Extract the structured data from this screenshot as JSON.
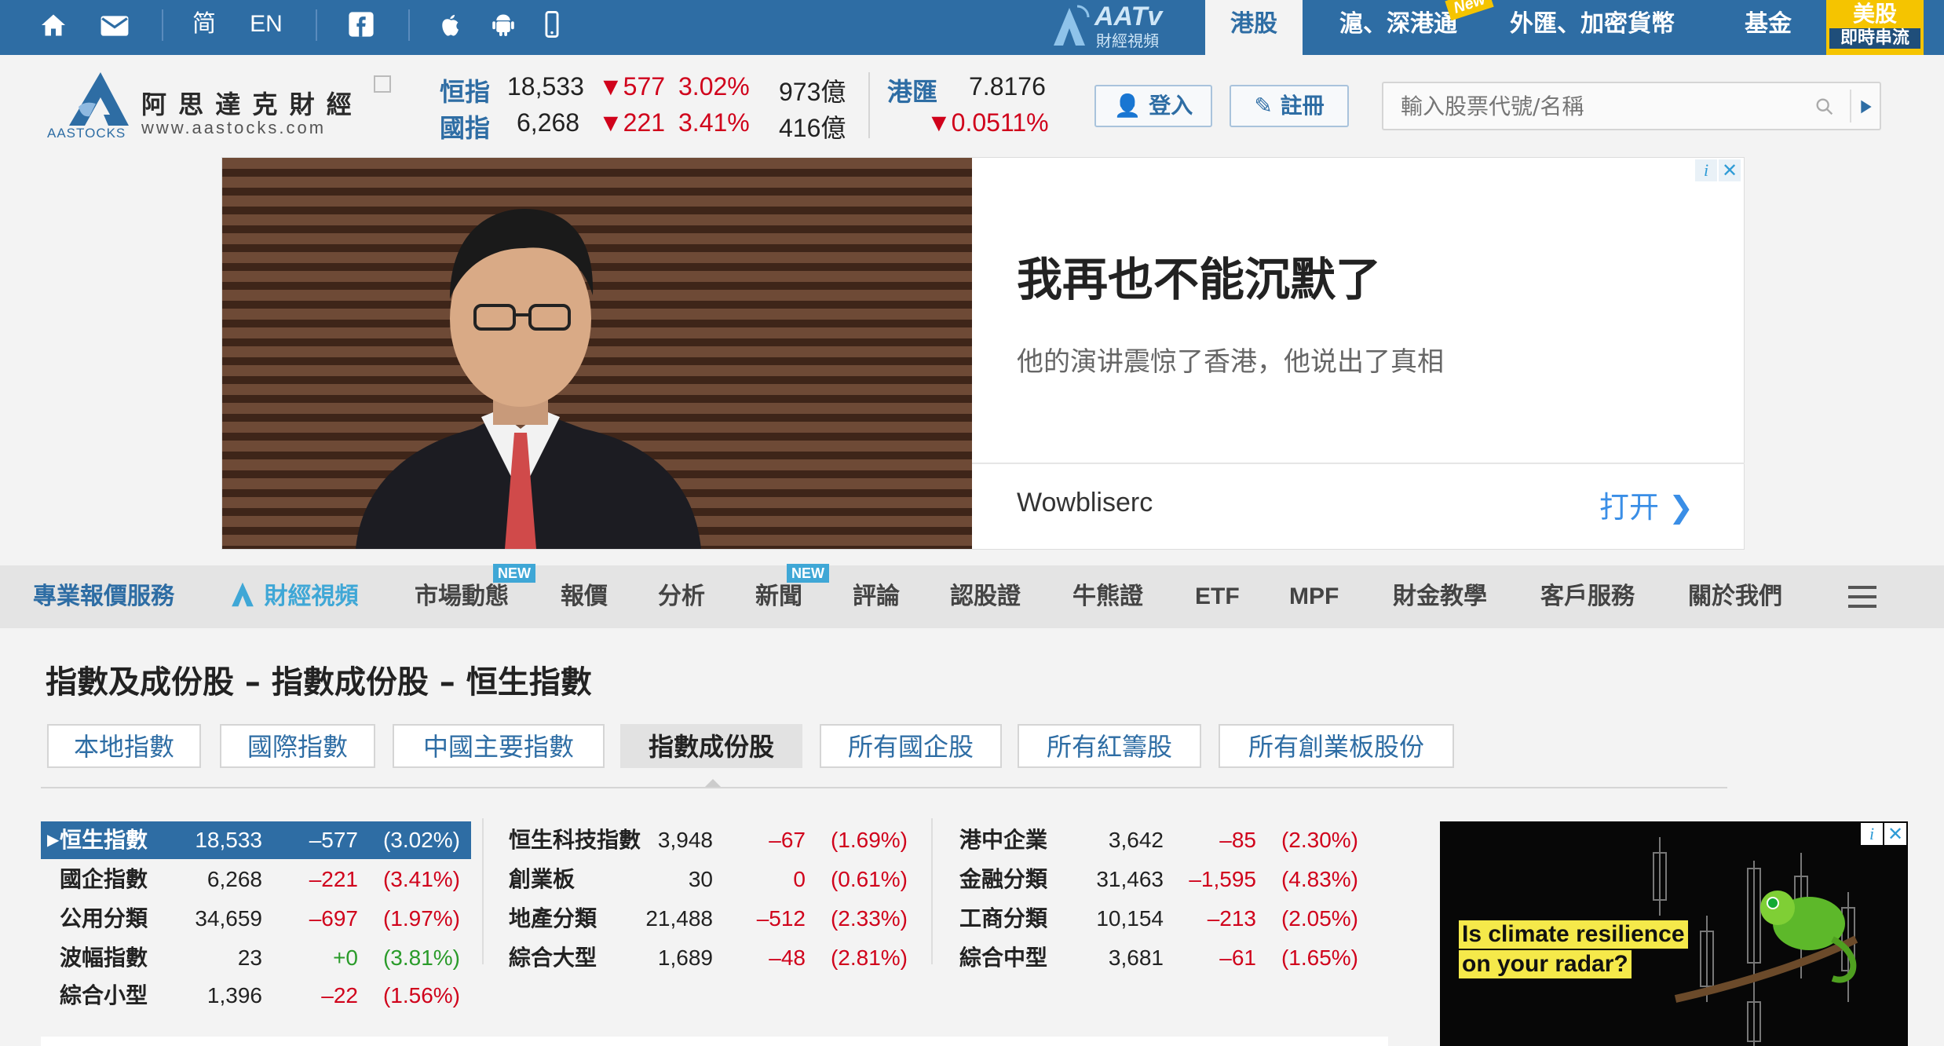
{
  "topbar": {
    "home_icon": "home-icon",
    "mail_icon": "mail-icon",
    "lang_simplified": "简",
    "lang_en": "EN",
    "facebook_icon": "facebook-icon",
    "apple_icon": "apple-icon",
    "android_icon": "android-icon",
    "mobile_icon": "mobile-icon",
    "aatv_logo": "AATv",
    "aatv_sub": "財經視頻",
    "tabs": [
      "港股",
      "滬、深港通",
      "外匯、加密貨幣",
      "基金"
    ],
    "new_tag": "New",
    "us_tab_title": "美股",
    "us_tab_sub": "即時串流"
  },
  "header": {
    "logo_name": "阿 思 達 克 財 經",
    "logo_url": "www.aastocks.com",
    "logo_mark": "AASTOCKS",
    "hsi_label": "恒指",
    "hsi_value": "18,533",
    "hsi_change": "▼577",
    "hsi_pct": "3.02%",
    "hsi_turnover": "973億",
    "hscei_label": "國指",
    "hscei_value": "6,268",
    "hscei_change": "▼221",
    "hscei_pct": "3.41%",
    "hscei_turnover": "416億",
    "fx_label": "港匯",
    "fx_value": "7.8176",
    "fx_change": "▼0.0511%",
    "login_label": "登入",
    "register_label": "註冊",
    "search_placeholder": "輸入股票代號/名稱"
  },
  "ad": {
    "headline": "我再也不能沉默了",
    "subline": "他的演讲震惊了香港，他说出了真相",
    "advertiser": "Wowbliserc",
    "cta": "打开"
  },
  "nav": {
    "items": [
      "專業報價服務",
      "財經視頻",
      "市場動態",
      "報價",
      "分析",
      "新聞",
      "評論",
      "認股證",
      "牛熊證",
      "ETF",
      "MPF",
      "財金教學",
      "客戶服務",
      "關於我們"
    ],
    "new_badge": "NEW"
  },
  "page": {
    "title": "指數及成份股 – 指數成份股 – 恒生指數",
    "subtabs": [
      "本地指數",
      "國際指數",
      "中國主要指數",
      "指數成份股",
      "所有國企股",
      "所有紅籌股",
      "所有創業板股份"
    ]
  },
  "indices": {
    "col1": [
      {
        "name": "恒生指數",
        "value": "18,533",
        "change": "–577",
        "pct": "(3.02%)"
      },
      {
        "name": "國企指數",
        "value": "6,268",
        "change": "–221",
        "pct": "(3.41%)"
      },
      {
        "name": "公用分類",
        "value": "34,659",
        "change": "–697",
        "pct": "(1.97%)"
      },
      {
        "name": "波幅指數",
        "value": "23",
        "change": "+0",
        "pct": "(3.81%)"
      },
      {
        "name": "綜合小型",
        "value": "1,396",
        "change": "–22",
        "pct": "(1.56%)"
      }
    ],
    "col2": [
      {
        "name": "恒生科技指數",
        "value": "3,948",
        "change": "–67",
        "pct": "(1.69%)"
      },
      {
        "name": "創業板",
        "value": "30",
        "change": "0",
        "pct": "(0.61%)"
      },
      {
        "name": "地產分類",
        "value": "21,488",
        "change": "–512",
        "pct": "(2.33%)"
      },
      {
        "name": "綜合大型",
        "value": "1,689",
        "change": "–48",
        "pct": "(2.81%)"
      }
    ],
    "col3": [
      {
        "name": "港中企業",
        "value": "3,642",
        "change": "–85",
        "pct": "(2.30%)"
      },
      {
        "name": "金融分類",
        "value": "31,463",
        "change": "–1,595",
        "pct": "(4.83%)"
      },
      {
        "name": "工商分類",
        "value": "10,154",
        "change": "–213",
        "pct": "(2.05%)"
      },
      {
        "name": "綜合中型",
        "value": "3,681",
        "change": "–61",
        "pct": "(1.65%)"
      }
    ]
  },
  "side_ad": {
    "line1": "Is climate resilience",
    "line2": "on your radar?"
  }
}
